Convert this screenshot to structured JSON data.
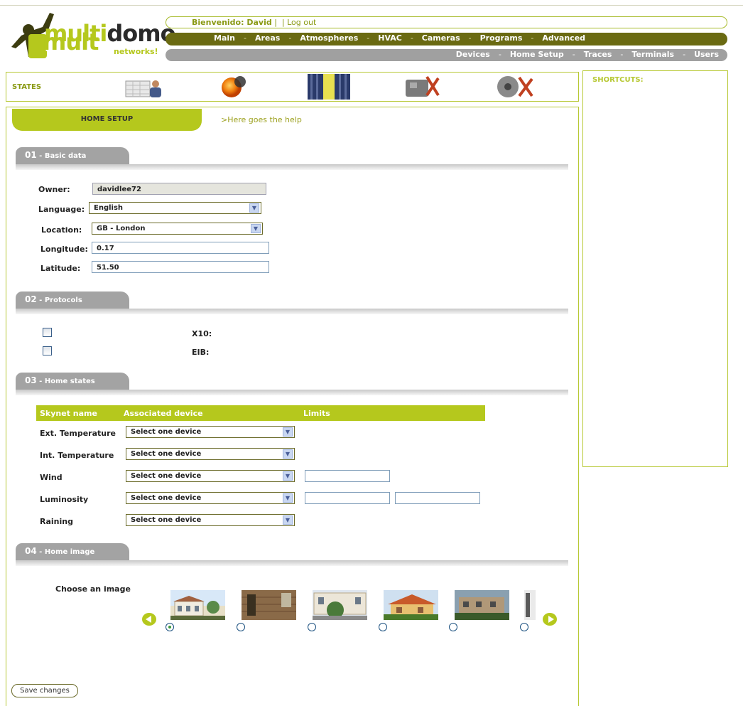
{
  "header": {
    "logo_text": "multidomo",
    "logo_sub": "networks!",
    "welcome_label": "Bienvenido: David",
    "welcome_sep": " |  | ",
    "logout_label": "Log out"
  },
  "main_nav": [
    "Main",
    "Areas",
    "Atmospheres",
    "HVAC",
    "Cameras",
    "Programs",
    "Advanced"
  ],
  "sub_nav": [
    "Devices",
    "Home Setup",
    "Traces",
    "Terminals",
    "Users"
  ],
  "states": {
    "label": "STATES",
    "icons": [
      "calendar-user-icon",
      "sun-icon",
      "window-blind-icon",
      "disabled-device-icon",
      "disabled-speaker-icon"
    ]
  },
  "shortcuts": {
    "label": "SHORTCUTS:"
  },
  "page": {
    "tab_title": "HOME SETUP",
    "help_text": ">Here goes the help"
  },
  "sections": {
    "basic": {
      "num": "01",
      "title": "Basic data"
    },
    "protocols": {
      "num": "02",
      "title": "Protocols"
    },
    "states": {
      "num": "03",
      "title": "Home states"
    },
    "image": {
      "num": "04",
      "title": "Home image"
    }
  },
  "basic_data": {
    "owner_label": "Owner:",
    "owner_value": "davidlee72",
    "language_label": "Language:",
    "language_value": "English",
    "location_label": "Location:",
    "location_value": "GB - London",
    "longitude_label": "Longitude:",
    "longitude_value": "0.17",
    "latitude_label": "Latitude:",
    "latitude_value": "51.50"
  },
  "protocols": [
    {
      "label": "X10:",
      "checked": false
    },
    {
      "label": "EIB:",
      "checked": false
    }
  ],
  "home_states": {
    "columns": [
      "Skynet name",
      "Associated device",
      "Limits"
    ],
    "rows": [
      {
        "name": "Ext. Temperature",
        "device": "Select one device",
        "limits": 0
      },
      {
        "name": "Int. Temperature",
        "device": "Select one device",
        "limits": 0
      },
      {
        "name": "Wind",
        "device": "Select one device",
        "limits": 1
      },
      {
        "name": "Luminosity",
        "device": "Select one device",
        "limits": 2
      },
      {
        "name": "Raining",
        "device": "Select one device",
        "limits": 0
      }
    ]
  },
  "home_image": {
    "choose_label": "Choose an image",
    "selected_index": 0
  },
  "save_label": "Save changes",
  "colors": {
    "accent": "#b5c81d",
    "nav_dark": "#6a6a12",
    "nav_grey": "#a0a0a0"
  }
}
